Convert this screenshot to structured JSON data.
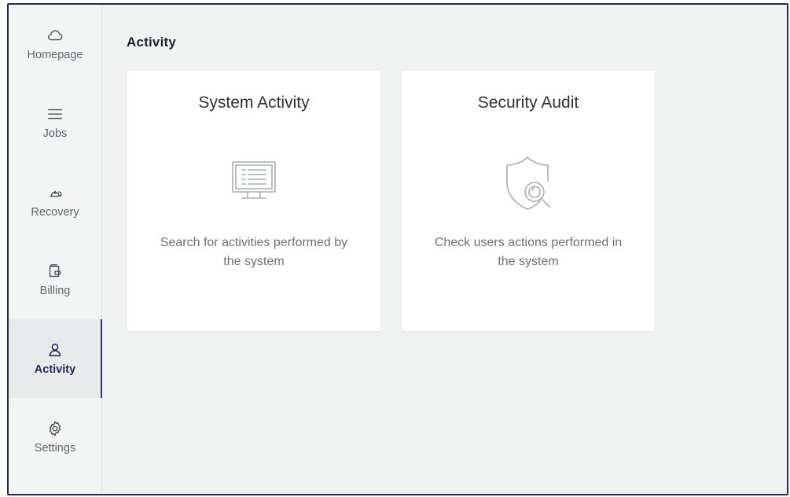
{
  "sidebar": {
    "items": [
      {
        "label": "Homepage",
        "icon": "cloud-icon"
      },
      {
        "label": "Jobs",
        "icon": "list-icon"
      },
      {
        "label": "Recovery",
        "icon": "recovery-icon"
      },
      {
        "label": "Billing",
        "icon": "billing-icon"
      },
      {
        "label": "Activity",
        "icon": "user-icon",
        "active": true
      },
      {
        "label": "Settings",
        "icon": "gear-icon"
      }
    ],
    "active_color": "#2c3572"
  },
  "main": {
    "title": "Activity",
    "cards": [
      {
        "title": "System Activity",
        "icon": "monitor-icon",
        "description": "Search for activities performed by the system"
      },
      {
        "title": "Security Audit",
        "icon": "shield-search-icon",
        "description": "Check users actions performed in the system"
      }
    ]
  }
}
